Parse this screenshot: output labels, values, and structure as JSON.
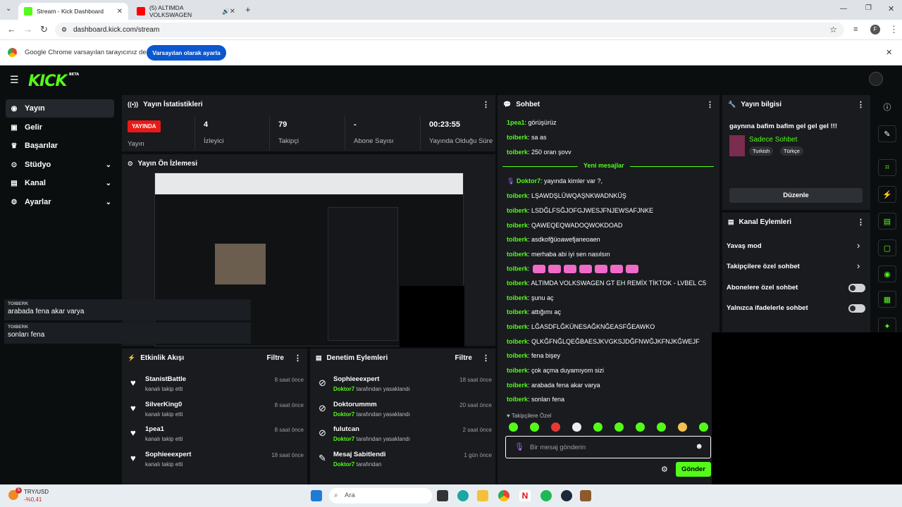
{
  "browser": {
    "tabs": [
      {
        "title": "Stream - Kick Dashboard",
        "fav_color": "#53fc18"
      },
      {
        "title": "(5) ALTIMDA VOLKSWAGEN",
        "fav_color": "#ff0000"
      }
    ],
    "url": "dashboard.kick.com/stream",
    "profile_initial": "F",
    "infobar_text": "Google Chrome varsayılan tarayıcınız değil",
    "infobar_button": "Varsayılan olarak ayarla"
  },
  "sidebar": {
    "logo": "KICK",
    "logo_badge": "BETA",
    "items": [
      {
        "label": "Yayın",
        "icon": "home-icon",
        "glyph": "◉"
      },
      {
        "label": "Gelir",
        "icon": "wallet-icon",
        "glyph": "▣"
      },
      {
        "label": "Başarılar",
        "icon": "trophy-icon",
        "glyph": "♛"
      },
      {
        "label": "Stüdyo",
        "icon": "studio-icon",
        "glyph": "⊙"
      },
      {
        "label": "Kanal",
        "icon": "channel-icon",
        "glyph": "▤"
      },
      {
        "label": "Ayarlar",
        "icon": "gear-icon",
        "glyph": "⚙"
      }
    ]
  },
  "stats": {
    "title": "Yayın İstatistikleri",
    "live_badge": "YAYINDA",
    "live_label": "Yayın",
    "items": [
      {
        "value": "4",
        "label": "İzleyici"
      },
      {
        "value": "79",
        "label": "Takipçi"
      },
      {
        "value": "-",
        "label": "Abone Sayısı"
      },
      {
        "value": "00:23:55",
        "label": "Yayında Olduğu Süre"
      }
    ]
  },
  "preview": {
    "title": "Yayın Ön İzlemesi",
    "overlay": [
      {
        "name": "TOIBERK",
        "text": "arabada fena akar varya"
      },
      {
        "name": "TOIBERK",
        "text": "sonları fena"
      }
    ]
  },
  "activity": {
    "title": "Etkinlik Akışı",
    "filter": "Filtre",
    "items": [
      {
        "name": "StanistBattle",
        "sub": "kanalı takip etti",
        "time": "8 saat önce"
      },
      {
        "name": "SilverKing0",
        "sub": "kanalı takip etti",
        "time": "8 saat önce"
      },
      {
        "name": "1pea1",
        "sub": "kanalı takip etti",
        "time": "8 saat önce"
      },
      {
        "name": "Sophieeexpert",
        "sub": "kanalı takip etti",
        "time": "18 saat önce"
      }
    ]
  },
  "moderation": {
    "title": "Denetim Eylemleri",
    "filter": "Filtre",
    "items": [
      {
        "name": "Sophieeexpert",
        "by": "Doktor7",
        "sub": "tarafından yasaklandı",
        "time": "18 saat önce",
        "icon": "ban-icon",
        "glyph": "⊘"
      },
      {
        "name": "Doktorummm",
        "by": "Doktor7",
        "sub": "tarafından yasaklandı",
        "time": "20 saat önce",
        "icon": "ban-icon",
        "glyph": "⊘"
      },
      {
        "name": "fulutcan",
        "by": "Doktor7",
        "sub": "tarafından yasaklandı",
        "time": "2 saat önce",
        "icon": "ban-icon",
        "glyph": "⊘"
      },
      {
        "name": "Mesaj Sabitlendi",
        "by": "Doktor7",
        "sub": "tarafından",
        "time": "1 gün önce",
        "icon": "pin-icon",
        "glyph": "📌"
      }
    ]
  },
  "chat": {
    "title": "Sohbet",
    "new_messages": "Yeni mesajlar",
    "messages_before": [
      {
        "user": "1pea1",
        "text": "görüşürüz"
      },
      {
        "user": "toiberk",
        "text": "sa as"
      },
      {
        "user": "toiberk",
        "text": "250 oran şovv"
      }
    ],
    "messages_after": [
      {
        "user": "Doktor7",
        "text": "yayında kimler var ?,"
      },
      {
        "user": "toiberk",
        "text": "LŞAWDŞLÜWQAŞNKWADNKÜŞ"
      },
      {
        "user": "toiberk",
        "text": "LSDĞLFSĞJOFGJWESJFNJEWSAFJNKE"
      },
      {
        "user": "toiberk",
        "text": "QAWEQEQWADOQWOKDOAD"
      },
      {
        "user": "toiberk",
        "text": "asdkofğüoawefjaneoaen"
      },
      {
        "user": "toiberk",
        "text": "merhaba abi iyi sen nasılsın"
      },
      {
        "user": "toiberk",
        "text": ""
      },
      {
        "user": "toiberk",
        "text": "ALTIMDA VOLKSWAGEN GT EH REMİX TİKTOK - LVBEL C5"
      },
      {
        "user": "toiberk",
        "text": "şunu aç"
      },
      {
        "user": "toiberk",
        "text": "attığımı aç"
      },
      {
        "user": "toiberk",
        "text": "LĞASDFLĞKÜNESAĞKNĞEASFĞEAWKO"
      },
      {
        "user": "toiberk",
        "text": "QLKĞFNĞLQEĞBAESJKVGKSJDĞFNWĞJKFNJKĞWEJF"
      },
      {
        "user": "toiberk",
        "text": "fena bişey"
      },
      {
        "user": "toiberk",
        "text": "çok açma duyamıyom sizi"
      },
      {
        "user": "toiberk",
        "text": "arabada fena akar varya"
      },
      {
        "user": "toiberk",
        "text": "sonları fena"
      }
    ],
    "followers_only": "Takipçilere Özel",
    "input_placeholder": "Bir mesaj gönderin",
    "send": "Gönder"
  },
  "stream_info": {
    "title": "Yayın bilgisi",
    "stream_title": "gaynına bafim bafim gel gel gel !!!",
    "category": "Sadece Sohbet",
    "tags": [
      "Turkish",
      "Türkçe"
    ],
    "edit": "Düzenle"
  },
  "channel_actions": {
    "title": "Kanal Eylemleri",
    "items": [
      {
        "label": "Yavaş mod",
        "control": "arrow"
      },
      {
        "label": "Takipçilere özel sohbet",
        "control": "arrow"
      },
      {
        "label": "Abonelere özel sohbet",
        "control": "toggle",
        "on": false
      },
      {
        "label": "Yalnızca ifadelerle sohbet",
        "control": "toggle",
        "on": false
      }
    ]
  },
  "taskbar": {
    "ticker": "TRY/USD",
    "change": "-%0,41",
    "badge": "5",
    "search": "Ara"
  }
}
